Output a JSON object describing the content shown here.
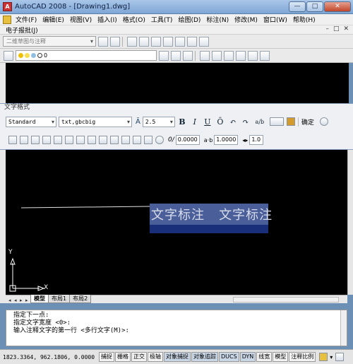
{
  "window": {
    "title": "AutoCAD 2008 - [Drawing1.dwg]",
    "minimize": "—",
    "maximize": "□",
    "close": "✕"
  },
  "menu": {
    "items": [
      "文件(F)",
      "编辑(E)",
      "视图(V)",
      "插入(I)",
      "格式(O)",
      "工具(T)",
      "绘图(D)",
      "标注(N)",
      "修改(M)",
      "窗口(W)",
      "帮助(H)"
    ]
  },
  "toolbar2": {
    "label": "电子报批(J)",
    "doc_min": "–",
    "doc_max": "□",
    "doc_close": "✕"
  },
  "workspace": {
    "selected": "二维草图与注释"
  },
  "layers": {
    "current": "0"
  },
  "text_format": {
    "title": "文字格式",
    "style": "Standard",
    "font": "txt,gbcbig",
    "height": "2.5",
    "bold": "B",
    "italic": "I",
    "underline": "U",
    "overline": "Ō",
    "undo": "↶",
    "redo": "↷",
    "stack": "a/b",
    "ok": "确定",
    "oblique": "0.0000",
    "tracking": "1.0000",
    "width_factor": "1.0"
  },
  "drawing": {
    "annotation_text": "文字标注   文字标注",
    "axis_x": "X",
    "axis_y": "Y"
  },
  "tabs": {
    "items": [
      "模型",
      "布局1",
      "布局2"
    ]
  },
  "command": {
    "lines": [
      "指定下一点:",
      "指定文字宽度 <0>:",
      "输入注释文字的第一行 <多行文字(M)>:"
    ]
  },
  "status": {
    "coords": "1823.3364, 962.1806, 0.0000",
    "buttons": [
      "捕捉",
      "栅格",
      "正交",
      "极轴",
      "对象捕捉",
      "对象追踪",
      "DUCS",
      "DYN",
      "线宽",
      "模型",
      "注释比例"
    ]
  }
}
